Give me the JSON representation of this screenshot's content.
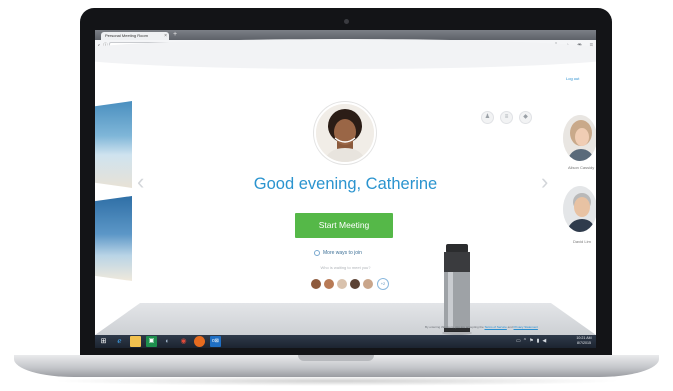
{
  "browser": {
    "tab_title": "Personal Meeting Room",
    "tab_close": "×",
    "new_tab": "+",
    "url": "go.webex.com/meet/catherin",
    "search_placeholder": "Search",
    "nav_back": "‹",
    "nav_info": "ⓘ",
    "reload": "C",
    "dropdown": "▾"
  },
  "page": {
    "logout": "Log out",
    "greeting": "Good evening, Catherine",
    "start_button": "Start Meeting",
    "more_ways": "More ways to join",
    "waiting_label": "Who is waiting to meet you?",
    "more_count": "+2",
    "legal": "By entering this room, you are accepting the",
    "terms": "Terms of Service",
    "and": "and",
    "privacy": "Privacy Statement",
    "right_person_1": "Alison Cassidy",
    "right_person_2": "David Lim"
  },
  "taskbar": {
    "time": "10:21 AM",
    "date": "8/7/2015"
  },
  "colors": {
    "accent": "#2b94cf",
    "start_button": "#55b848",
    "taskbar": "#1c2430"
  }
}
